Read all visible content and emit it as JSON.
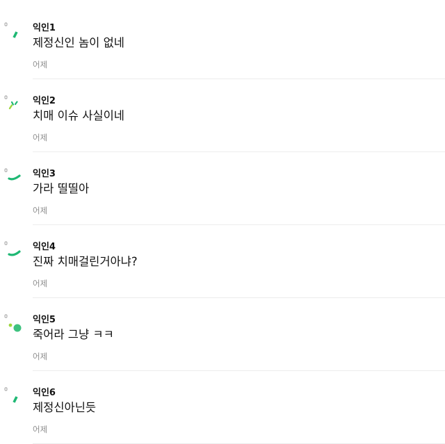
{
  "colors": {
    "accent_green": "#1fb874",
    "accent_lime": "#9cd63c",
    "accent_round": "#3ec27f",
    "text": "#111111",
    "date": "#8e8e8e",
    "divider": "#ececec"
  },
  "comments": [
    {
      "nickname": "익인1",
      "body": "제정신인 놈이 없네",
      "date": "어제",
      "avatar_icon": "slash-avatar-icon"
    },
    {
      "nickname": "익인2",
      "body": "치매 이슈 사실이네",
      "date": "어제",
      "avatar_icon": "double-dash-avatar-icon"
    },
    {
      "nickname": "익인3",
      "body": "가라 띨띨아",
      "date": "어제",
      "avatar_icon": "arc-avatar-icon"
    },
    {
      "nickname": "익인4",
      "body": "진짜 치매걸린거아냐?",
      "date": "어제",
      "avatar_icon": "arc-avatar-icon"
    },
    {
      "nickname": "익인5",
      "body": "죽어라 그냥 ㅋㅋ",
      "date": "어제",
      "avatar_icon": "dot-avatar-icon"
    },
    {
      "nickname": "익인6",
      "body": "제정신아닌듯",
      "date": "어제",
      "avatar_icon": "slash-avatar-icon"
    }
  ]
}
